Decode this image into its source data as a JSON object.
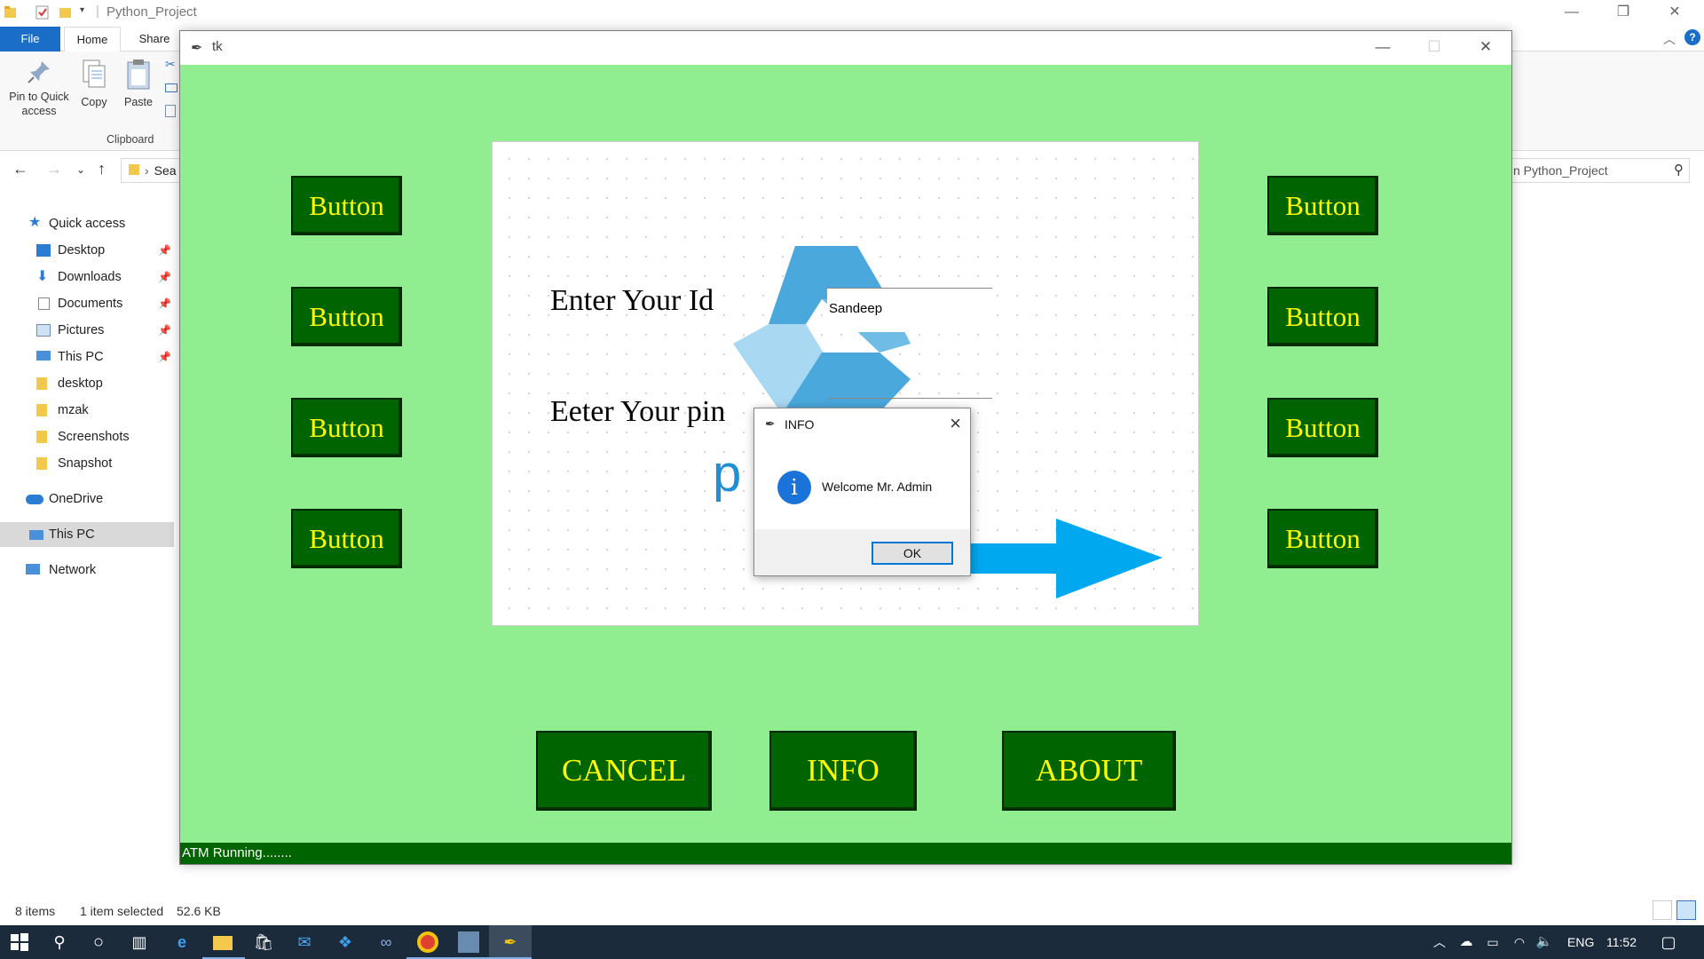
{
  "explorer": {
    "title": "Python_Project",
    "tabs": {
      "file": "File",
      "home": "Home",
      "share": "Share"
    },
    "ribbon": {
      "pin_label": "Pin to Quick access",
      "copy_label": "Copy",
      "paste_label": "Paste",
      "group_label": "Clipboard"
    },
    "address_text": "Sea",
    "search_placeholder": "n Python_Project",
    "sidebar": {
      "quick_access": "Quick access",
      "items": [
        {
          "label": "Desktop",
          "icon": "desktop-icon"
        },
        {
          "label": "Downloads",
          "icon": "downloads-icon"
        },
        {
          "label": "Documents",
          "icon": "documents-icon"
        },
        {
          "label": "Pictures",
          "icon": "pictures-icon"
        },
        {
          "label": "This PC",
          "icon": "this-pc-icon"
        },
        {
          "label": "desktop",
          "icon": "folder-icon"
        },
        {
          "label": "mzak",
          "icon": "folder-icon"
        },
        {
          "label": "Screenshots",
          "icon": "folder-icon"
        },
        {
          "label": "Snapshot",
          "icon": "folder-icon"
        }
      ],
      "onedrive": "OneDrive",
      "this_pc": "This PC",
      "network": "Network"
    },
    "status": {
      "items": "8 items",
      "selected": "1 item selected",
      "size": "52.6 KB"
    }
  },
  "tk": {
    "title": "tk",
    "left_buttons": [
      "Button",
      "Button",
      "Button",
      "Button"
    ],
    "right_buttons": [
      "Button",
      "Button",
      "Button",
      "Button"
    ],
    "id_label": "Enter Your Id",
    "pin_label": "Eeter Your pin",
    "id_value": "Sandeep",
    "bottom_buttons": {
      "cancel": "CANCEL",
      "info": "INFO",
      "about": "ABOUT"
    },
    "status": "ATM Running........",
    "logo_letter": "p"
  },
  "msgbox": {
    "title": "INFO",
    "message": "Welcome Mr. Admin",
    "ok": "OK",
    "icon": "info-icon"
  },
  "taskbar": {
    "language": "ENG",
    "time": "11:52"
  },
  "colors": {
    "tk_bg": "#90ee90",
    "button_bg": "#006400",
    "button_text": "#ffff00",
    "arrow": "#00a8f0",
    "logo_dark": "#4aa8dc",
    "logo_light": "#a9d8f2"
  }
}
